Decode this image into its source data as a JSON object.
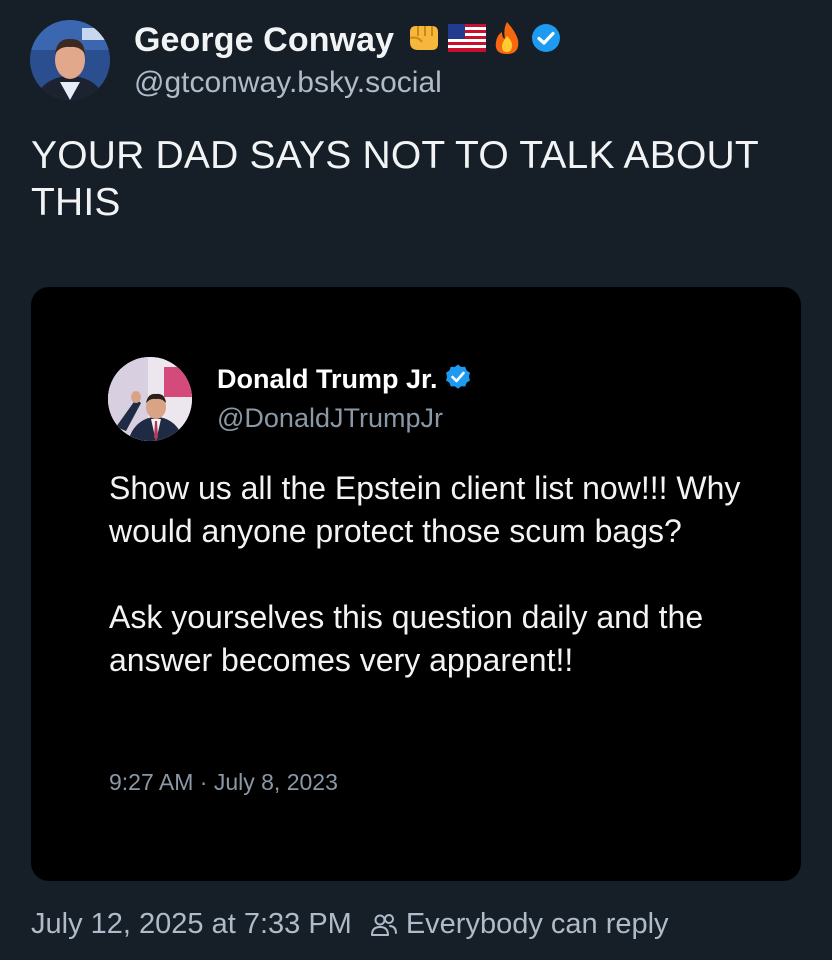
{
  "author": {
    "display_name": "George Conway",
    "handle": "@gtconway.bsky.social",
    "emojis": [
      "fist-icon",
      "us-flag-icon",
      "fire-icon"
    ],
    "verified": true,
    "verified_color": "#1d9bf0"
  },
  "post": {
    "text": "YOUR DAD SAYS NOT TO TALK ABOUT THIS"
  },
  "embed": {
    "author": {
      "display_name": "Donald Trump Jr.",
      "handle": "@DonaldJTrumpJr",
      "verified": true
    },
    "paragraphs": [
      "Show us all the Epstein client list now!!! Why would anyone protect those scum bags?",
      "Ask yourselves this question daily and the answer becomes very apparent!!"
    ],
    "timestamp": "9:27 AM · July 8, 2023"
  },
  "footer": {
    "timestamp": "July 12, 2025 at 7:33 PM",
    "reply_setting": "Everybody can reply",
    "reply_icon": "people-icon"
  },
  "colors": {
    "background": "#161e27",
    "primary_text": "#f1f3f5",
    "secondary_text": "#aebbc9",
    "embed_background": "#000000",
    "accent": "#1d9bf0"
  }
}
